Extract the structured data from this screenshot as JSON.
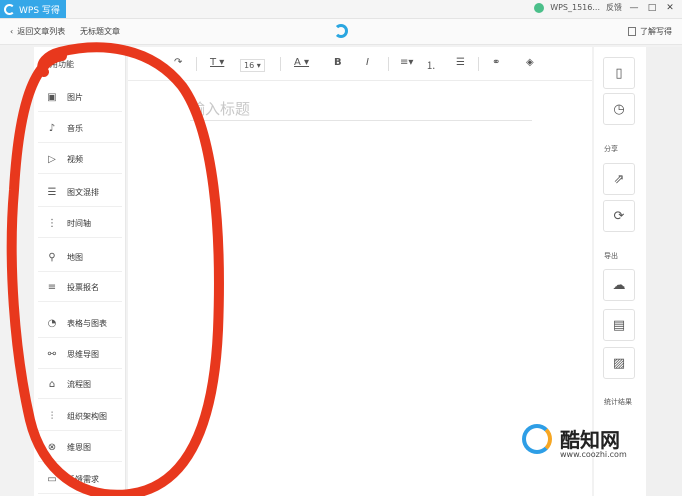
{
  "titlebar": {
    "app_name": "WPS 写得",
    "account": "WPS_1516...",
    "feedback": "反馈",
    "min": "—",
    "max": "□",
    "close": "✕"
  },
  "topbar": {
    "back_label": "返回文章列表",
    "untitled_label": "无标题文章",
    "learn_label": "了解写得"
  },
  "sidebar": {
    "title": "常用功能",
    "items": [
      {
        "icon": "image-icon",
        "glyph": "▣",
        "label": "图片"
      },
      {
        "icon": "music-icon",
        "glyph": "♪",
        "label": "音乐"
      },
      {
        "icon": "video-icon",
        "glyph": "▷",
        "label": "视频"
      },
      {
        "icon": "text-image-layout-icon",
        "glyph": "☰",
        "label": "图文混排"
      },
      {
        "icon": "timeline-icon",
        "glyph": "⋮",
        "label": "时间轴"
      },
      {
        "icon": "map-pin-icon",
        "glyph": "⚲",
        "label": "地图"
      },
      {
        "icon": "vote-icon",
        "glyph": "≡",
        "label": "投票报名"
      },
      {
        "icon": "pie-chart-icon",
        "glyph": "◔",
        "label": "表格与图表"
      },
      {
        "icon": "mind-map-icon",
        "glyph": "⚯",
        "label": "思维导图"
      },
      {
        "icon": "flowchart-icon",
        "glyph": "⌂",
        "label": "流程图"
      },
      {
        "icon": "org-chart-icon",
        "glyph": "⫶",
        "label": "组织架构图"
      },
      {
        "icon": "venn-icon",
        "glyph": "⊗",
        "label": "维恩图"
      },
      {
        "icon": "feedback-icon",
        "glyph": "▭",
        "label": "反馈需求"
      }
    ]
  },
  "editor_toolbar": {
    "font_size": "16"
  },
  "editor": {
    "title_placeholder": "输入标题"
  },
  "rightbar": {
    "share_label": "分享",
    "export_label": "导出",
    "stats_label": "统计结果"
  },
  "watermark": {
    "brand": "酷知网",
    "url": "www.coozhi.com"
  }
}
